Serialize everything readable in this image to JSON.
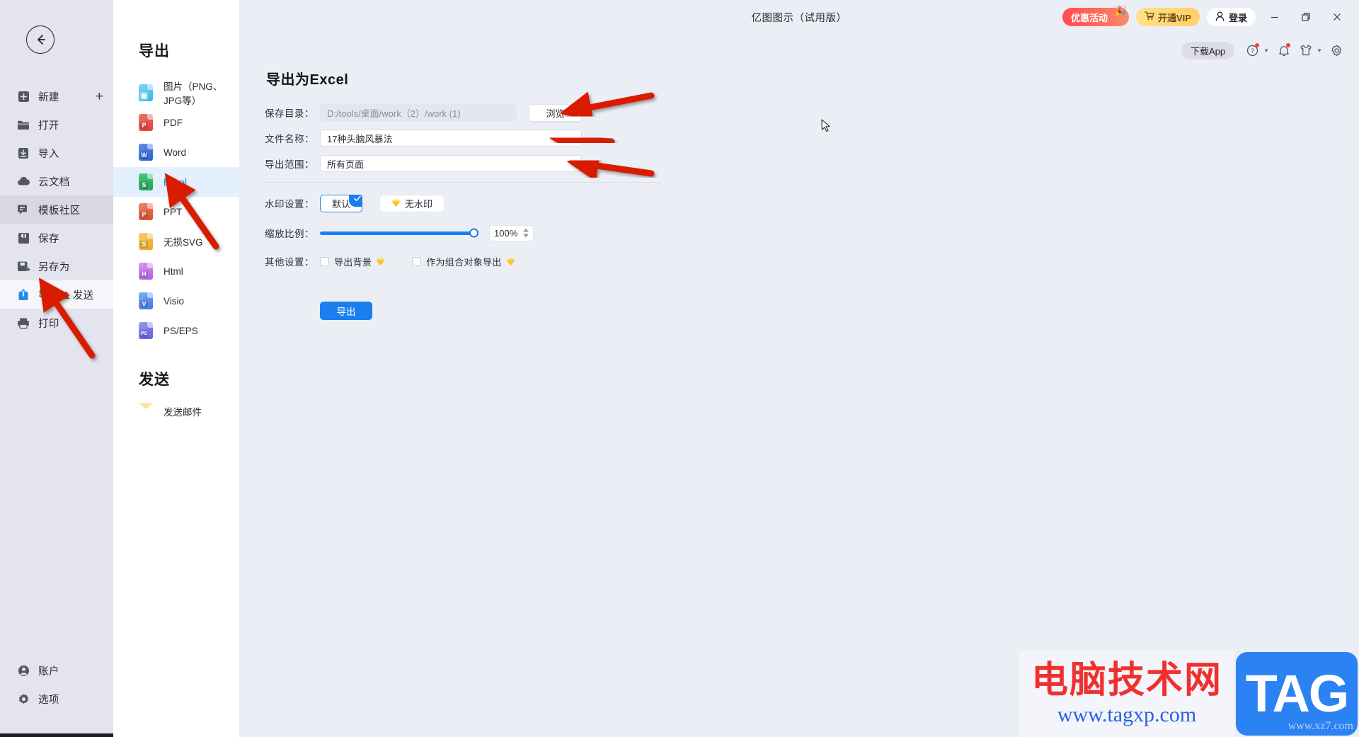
{
  "window": {
    "title": "亿图图示（试用版）",
    "controls": {
      "minimize": "—",
      "maximize": "❐",
      "close": "✕"
    }
  },
  "topbar": {
    "promo_label": "优惠活动",
    "vip_label": "开通VIP",
    "login_label": "登录",
    "download_app_label": "下载App",
    "icons": [
      "help-icon",
      "bell-icon",
      "skin-icon",
      "gear-icon"
    ]
  },
  "rail": {
    "back_icon": "back-arrow-icon",
    "items": [
      {
        "label": "新建",
        "icon": "new-file-icon",
        "trailing": "+",
        "state": "normal"
      },
      {
        "label": "打开",
        "icon": "folder-open-icon",
        "state": "normal"
      },
      {
        "label": "导入",
        "icon": "import-icon",
        "state": "normal"
      },
      {
        "label": "云文档",
        "icon": "cloud-icon",
        "state": "normal"
      },
      {
        "label": "模板社区",
        "icon": "community-icon",
        "state": "hover"
      },
      {
        "label": "保存",
        "icon": "save-icon",
        "state": "normal"
      },
      {
        "label": "另存为",
        "icon": "save-as-icon",
        "state": "normal"
      },
      {
        "label": "导出 & 发送",
        "icon": "export-send-icon",
        "state": "active"
      },
      {
        "label": "打印",
        "icon": "print-icon",
        "state": "normal"
      }
    ],
    "bottom_items": [
      {
        "label": "账户",
        "icon": "account-icon"
      },
      {
        "label": "选项",
        "icon": "options-gear-icon"
      }
    ]
  },
  "formats": {
    "export_title": "导出",
    "items": [
      {
        "label": "图片（PNG、JPG等）",
        "icon": "image-file-icon",
        "letter": "",
        "color1": "#7fd6f5",
        "color2": "#36b6e8",
        "selected": false
      },
      {
        "label": "PDF",
        "icon": "pdf-file-icon",
        "letter": "P",
        "color1": "#f4706b",
        "color2": "#e04038",
        "selected": false
      },
      {
        "label": "Word",
        "icon": "word-file-icon",
        "letter": "W",
        "color1": "#5b8dea",
        "color2": "#2a5fd0",
        "selected": false
      },
      {
        "label": "Excel",
        "icon": "excel-file-icon",
        "letter": "S",
        "color1": "#4cc97a",
        "color2": "#18a558",
        "selected": true
      },
      {
        "label": "PPT",
        "icon": "ppt-file-icon",
        "letter": "P",
        "color1": "#f08268",
        "color2": "#dd4e2c",
        "selected": false
      },
      {
        "label": "无损SVG",
        "icon": "svg-file-icon",
        "letter": "S",
        "color1": "#f7cf6a",
        "color2": "#e8a81f",
        "selected": false
      },
      {
        "label": "Html",
        "icon": "html-file-icon",
        "letter": "H",
        "color1": "#d89bf0",
        "color2": "#b45ce0",
        "selected": false
      },
      {
        "label": "Visio",
        "icon": "visio-file-icon",
        "letter": "V",
        "color1": "#7fb0f5",
        "color2": "#3a79e8",
        "selected": false
      },
      {
        "label": "PS/EPS",
        "icon": "ps-file-icon",
        "letter": "PS",
        "color1": "#9a9bea",
        "color2": "#5b5ce0",
        "selected": false
      }
    ],
    "send_title": "发送",
    "send_items": [
      {
        "label": "发送邮件",
        "icon": "mail-icon"
      }
    ]
  },
  "form": {
    "heading": "导出为Excel",
    "save_dir": {
      "label": "保存目录：",
      "value": "D:/tools/桌面/work（2）/work (1)",
      "browse_label": "浏览"
    },
    "file_name": {
      "label": "文件名称：",
      "value": "17种头脑风暴法"
    },
    "export_range": {
      "label": "导出范围：",
      "value": "所有页面",
      "options": [
        "所有页面"
      ]
    },
    "watermark": {
      "label": "水印设置：",
      "options": [
        {
          "label": "默认",
          "selected": true,
          "vip": false
        },
        {
          "label": "无水印",
          "selected": false,
          "vip": true
        }
      ]
    },
    "scale": {
      "label": "缩放比例：",
      "value": "100%",
      "percent": 100
    },
    "other": {
      "label": "其他设置：",
      "checkboxes": [
        {
          "label": "导出背景",
          "checked": false,
          "vip": true
        },
        {
          "label": "作为组合对象导出",
          "checked": false,
          "vip": true
        }
      ]
    },
    "submit_label": "导出"
  },
  "watermark_overlay": {
    "cn": "电脑技术网",
    "url": "www.tagxp.com",
    "tag": "TAG",
    "sub": "www.xz7.com"
  },
  "colors": {
    "accent": "#1a7ef0",
    "selected_bg": "#e4f0fd",
    "panel_bg": "#eceef6",
    "rail_bg": "#e3e4ee",
    "annotation": "#d81e06"
  }
}
